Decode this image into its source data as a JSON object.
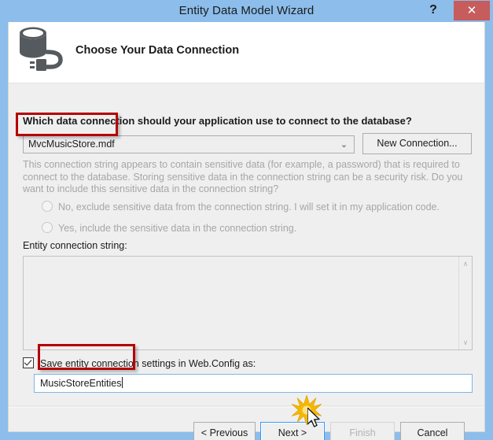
{
  "window": {
    "title": "Entity Data Model Wizard",
    "help_label": "?",
    "close_label": "✕",
    "titlebar_color": "#8cbdeb",
    "close_color": "#c75c5c"
  },
  "header": {
    "icon": "database-connection-icon",
    "title": "Choose Your Data Connection"
  },
  "main": {
    "prompt": "Which data connection should your application use to connect to the database?",
    "connection_combo": {
      "name": "data-connection-combobox",
      "value": "MvcMusicStore.mdf",
      "arrow": "⌄"
    },
    "new_connection_button": "New Connection...",
    "sensitive_text": "This connection string appears to contain sensitive data (for example, a password) that is required to connect to the database. Storing sensitive data in the connection string can be a security risk. Do you want to include this sensitive data in the connection string?",
    "radios": [
      {
        "label": "No, exclude sensitive data from the connection string. I will set it in my application code.",
        "selected": false,
        "disabled": true
      },
      {
        "label": "Yes, include the sensitive data in the connection string.",
        "selected": false,
        "disabled": true
      }
    ],
    "entity_connection_string_label": "Entity connection string:",
    "entity_connection_string_value": "",
    "scroll_up": "∧",
    "scroll_down": "∨",
    "save_checkbox": {
      "label": "Save entity connection settings in Web.Config as:",
      "checked": true
    },
    "entities_name_input": {
      "value": "MusicStoreEntities",
      "placeholder": ""
    }
  },
  "footer": {
    "buttons": [
      {
        "label": "< Previous",
        "disabled": false,
        "focused": false
      },
      {
        "label": "Next >",
        "disabled": false,
        "focused": true
      },
      {
        "label": "Finish",
        "disabled": true,
        "focused": false
      },
      {
        "label": "Cancel",
        "disabled": false,
        "focused": false
      }
    ]
  },
  "annotations": {
    "highlight_color": "#b60000",
    "boxes": [
      "connection-combobox-highlight",
      "entities-name-highlight"
    ],
    "click_burst_color": "#f5b800",
    "cursor": "arrow-pointer"
  }
}
